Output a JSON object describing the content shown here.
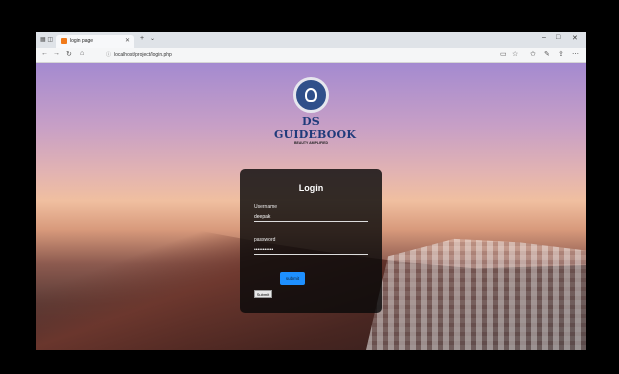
{
  "browser": {
    "tab_title": "login page",
    "url": "localhost/project/login.php"
  },
  "logo": {
    "title": "DS GUIDEBOOK",
    "tagline": "BEAUTY AMPLIFIED"
  },
  "form": {
    "heading": "Login",
    "username_label": "Username",
    "username_value": "deepak",
    "password_label": "password",
    "password_value": "•••••••••••",
    "submit_label": "submit",
    "secondary_submit_label": "Submit"
  },
  "colors": {
    "card_bg": "#0a0a0a",
    "submit_accent": "#1e90ff",
    "logo_text": "#1f3a7a"
  }
}
